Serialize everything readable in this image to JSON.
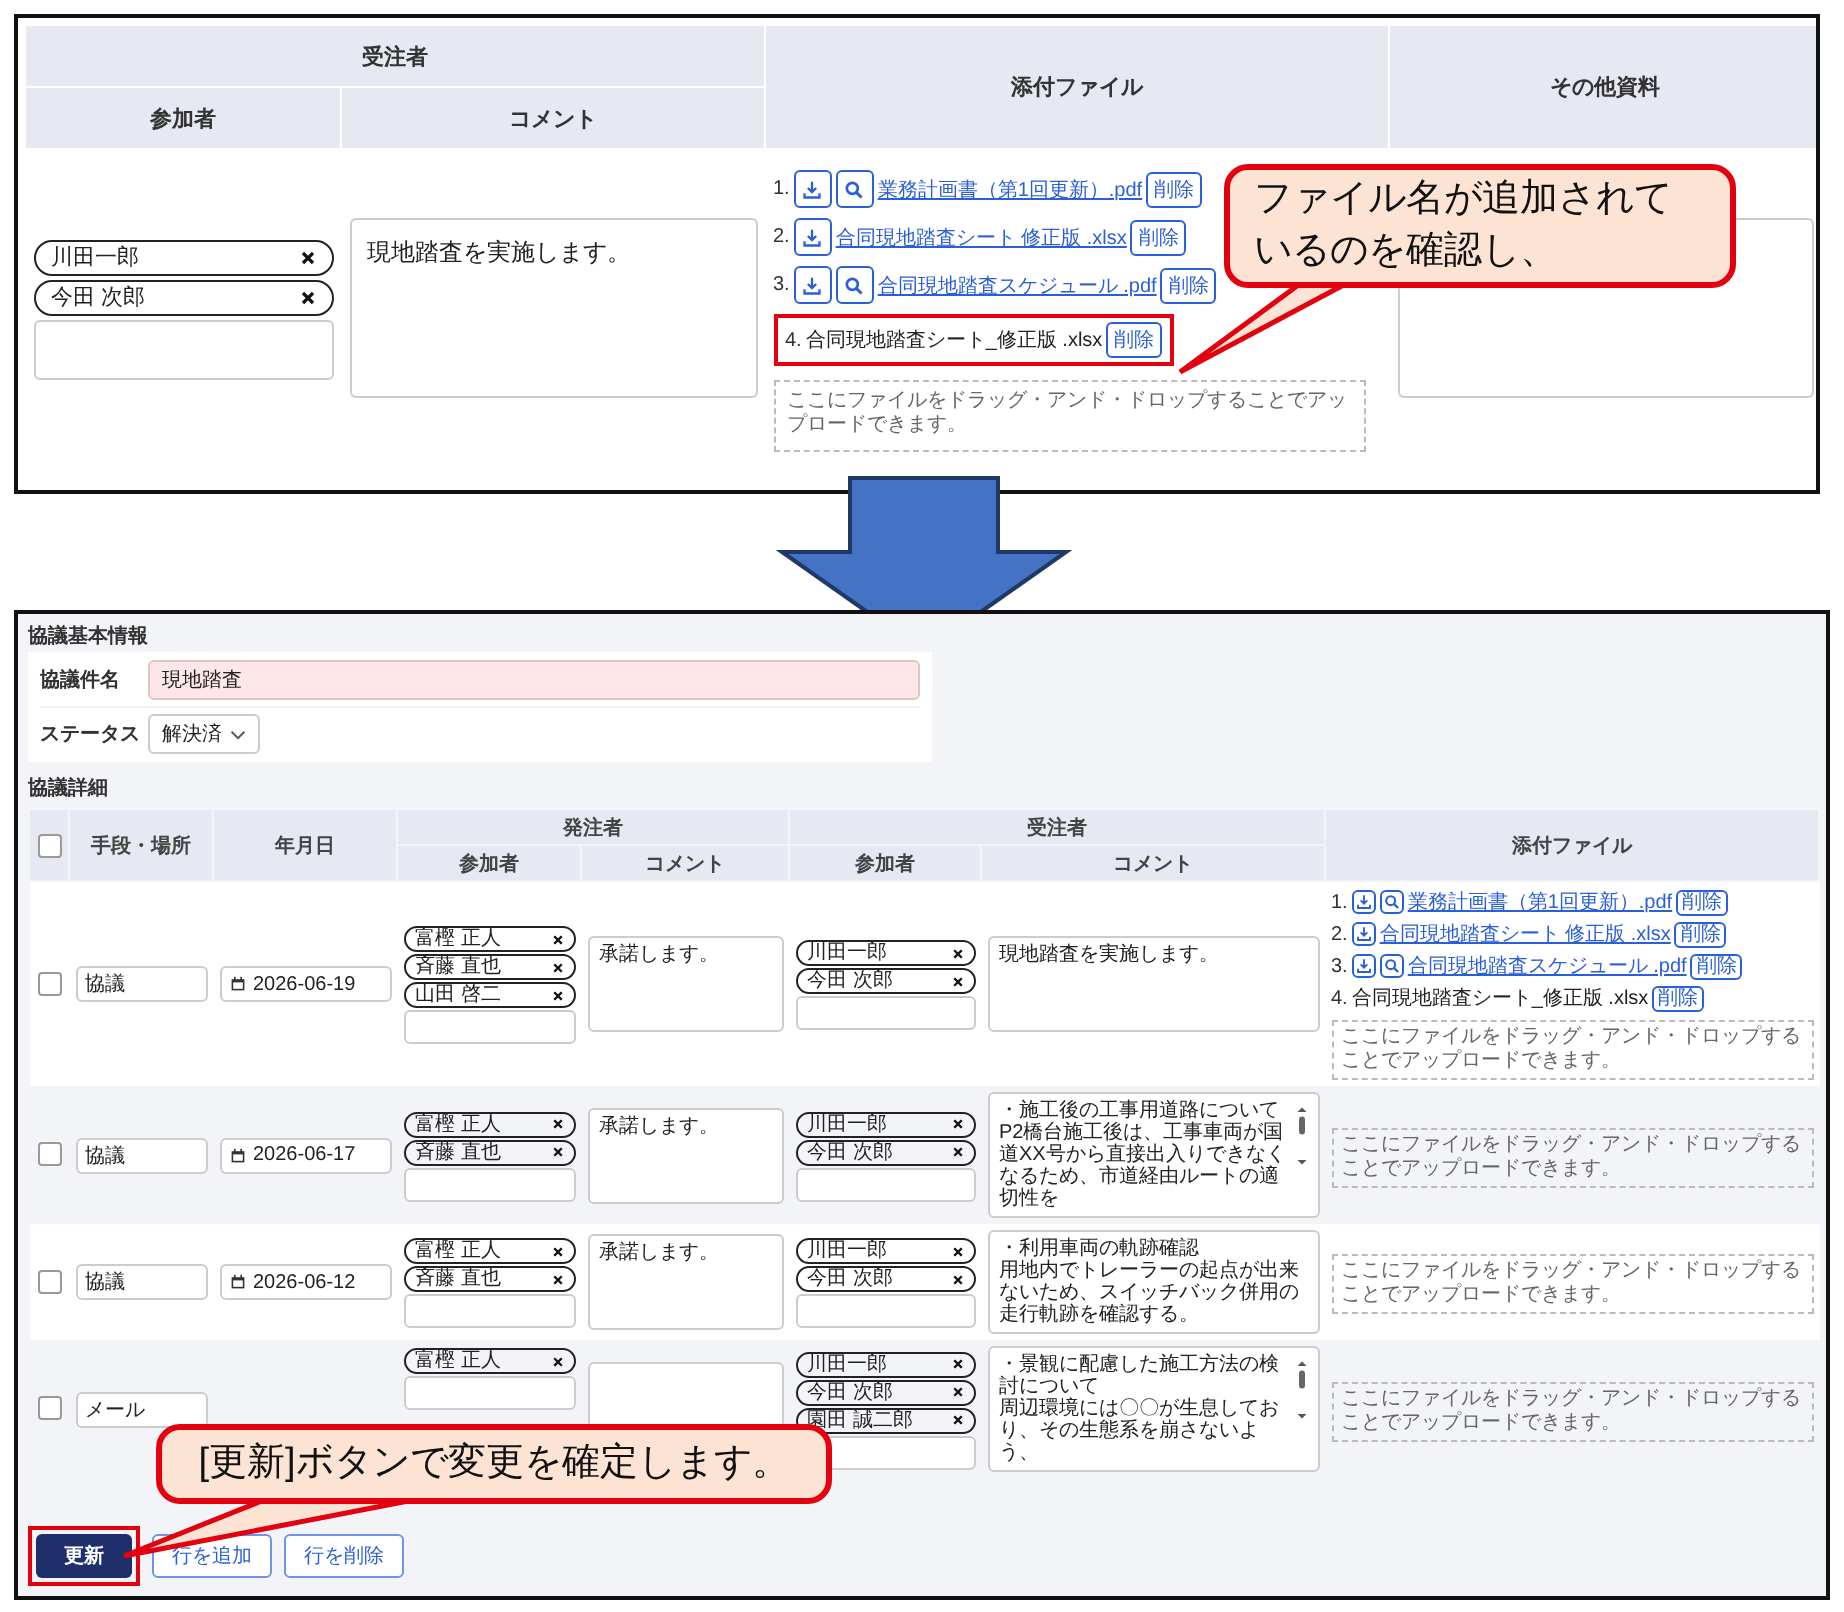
{
  "top_panel": {
    "headers": {
      "contractor": "受注者",
      "participants": "参加者",
      "comment": "コメント",
      "attachments": "添付ファイル",
      "other": "その他資料"
    },
    "participants": [
      "川田一郎",
      "今田 次郎"
    ],
    "comment": "現地踏査を実施します。",
    "files": [
      {
        "number": "1.",
        "name": "業務計画書（第1回更新）.pdf",
        "kind": "uploaded",
        "preview": true,
        "delete": "削除",
        "highlighted": false
      },
      {
        "number": "2.",
        "name": "合同現地踏査シート 修正版 .xlsx",
        "kind": "uploaded",
        "preview": false,
        "delete": "削除",
        "highlighted": false
      },
      {
        "number": "3.",
        "name": "合同現地踏査スケジュール .pdf",
        "kind": "uploaded",
        "preview": true,
        "delete": "削除",
        "highlighted": false
      },
      {
        "number": "4.",
        "name": "合同現地踏査シート_修正版 .xlsx",
        "kind": "new",
        "preview": false,
        "delete": "削除",
        "highlighted": true
      }
    ],
    "dropzone": "ここにファイルをドラッグ・アンド・ドロップすることでアップロードできます。",
    "callout": [
      "ファイル名が追加されて",
      "いるのを確認し、"
    ]
  },
  "bottom_panel": {
    "basic_title": "協議基本情報",
    "subject_label": "協議件名",
    "subject_value": "現地踏査",
    "status_label": "ステータス",
    "status_value": "解決済",
    "detail_title": "協議詳細",
    "select_all_checked": false,
    "headers": {
      "means": "手段・場所",
      "date": "年月日",
      "orderer": "発注者",
      "orderer_participants": "参加者",
      "orderer_comment": "コメント",
      "contractor": "受注者",
      "contractor_participants": "参加者",
      "contractor_comment": "コメント",
      "attachments": "添付ファイル"
    },
    "rows": [
      {
        "checked": false,
        "means": "協議",
        "date": "2026-06-19",
        "orderer_participants": [
          "富樫 正人",
          "斉藤 直也",
          "山田 啓二"
        ],
        "orderer_comment": "承諾します。",
        "contractor_participants": [
          "川田一郎",
          "今田 次郎"
        ],
        "contractor_comment": [
          "現地踏査を実施します。"
        ],
        "contractor_scrollable": false,
        "files": [
          {
            "number": "1.",
            "name": "業務計画書（第1回更新）.pdf",
            "kind": "uploaded",
            "preview": true,
            "delete": "削除"
          },
          {
            "number": "2.",
            "name": "合同現地踏査シート 修正版 .xlsx",
            "kind": "uploaded",
            "preview": false,
            "delete": "削除"
          },
          {
            "number": "3.",
            "name": "合同現地踏査スケジュール .pdf",
            "kind": "uploaded",
            "preview": true,
            "delete": "削除"
          },
          {
            "number": "4.",
            "name": "合同現地踏査シート_修正版 .xlsx",
            "kind": "new",
            "preview": false,
            "delete": "削除"
          }
        ],
        "dropzone": "ここにファイルをドラッグ・アンド・ドロップすることでアップロードできます。"
      },
      {
        "checked": false,
        "means": "協議",
        "date": "2026-06-17",
        "orderer_participants": [
          "富樫 正人",
          "斉藤 直也"
        ],
        "orderer_comment": "承諾します。",
        "contractor_participants": [
          "川田一郎",
          "今田 次郎"
        ],
        "contractor_comment": [
          "・施工後の工事用道路について",
          "P2橋台施工後は、工事車両が国道XX号から直接出入りできなくなるため、市道経由ルートの適切性を"
        ],
        "contractor_scrollable": true,
        "dropzone": "ここにファイルをドラッグ・アンド・ドロップすることでアップロードできます。"
      },
      {
        "checked": false,
        "means": "協議",
        "date": "2026-06-12",
        "orderer_participants": [
          "富樫 正人",
          "斉藤 直也"
        ],
        "orderer_comment": "承諾します。",
        "contractor_participants": [
          "川田一郎",
          "今田 次郎"
        ],
        "contractor_comment": [
          "・利用車両の軌跡確認",
          "用地内でトレーラーの起点が出来ないため、スイッチバック併用の走行軌跡を確認する。"
        ],
        "contractor_scrollable": false,
        "dropzone": "ここにファイルをドラッグ・アンド・ドロップすることでアップロードできます。"
      },
      {
        "checked": false,
        "means": "メール",
        "orderer_participants": [
          "富樫 正人"
        ],
        "contractor_participants": [
          "川田一郎",
          "今田 次郎",
          "園田 誠二郎"
        ],
        "contractor_comment": [
          "・景観に配慮した施工方法の検討について",
          "周辺環境には〇〇が生息しており、その生態系を崩さないよう、"
        ],
        "contractor_scrollable": true,
        "dropzone": "ここにファイルをドラッグ・アンド・ドロップすることでアップロードできます。"
      }
    ],
    "buttons": [
      {
        "label": "更新",
        "kind": "primary",
        "highlighted": true
      },
      {
        "label": "行を追加",
        "kind": "secondary",
        "highlighted": false
      },
      {
        "label": "行を削除",
        "kind": "secondary",
        "highlighted": false
      }
    ],
    "callout": [
      "[更新]ボタンで変更を確定します。"
    ]
  }
}
